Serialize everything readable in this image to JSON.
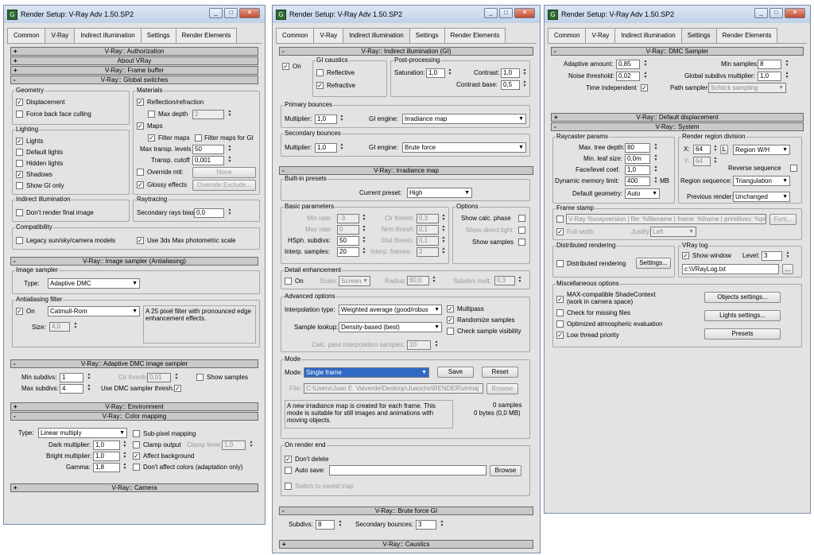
{
  "window_title": "Render Setup: V-Ray Adv 1.50.SP2",
  "tabs": [
    "Common",
    "V-Ray",
    "Indirect illumination",
    "Settings",
    "Render Elements"
  ],
  "w1": {
    "r_auth": "V-Ray:: Authorization",
    "r_about": "About VRay",
    "r_fb": "V-Ray:: Frame buffer",
    "r_gs": "V-Ray:: Global switches",
    "geometry": "Geometry",
    "displacement": "Displacement",
    "force_back": "Force back face culling",
    "lighting": "Lighting",
    "lights": "Lights",
    "default_lights": "Default lights",
    "hidden_lights": "Hidden lights",
    "shadows": "Shadows",
    "show_gi_only": "Show GI only",
    "materials": "Materials",
    "refl_refr": "Reflection/refraction",
    "max_depth": "Max depth",
    "max_depth_val": "2",
    "maps": "Maps",
    "filter_maps": "Filter maps",
    "filter_maps_gi": "Filter maps for GI",
    "max_transp": "Max transp. levels",
    "max_transp_val": "50",
    "transp_cutoff": "Transp. cutoff",
    "transp_cutoff_val": "0,001",
    "override_mtl": "Override mtl:",
    "none_btn": "None",
    "glossy": "Glossy effects",
    "override_excl": "Override Exclude...",
    "indirect": "Indirect illumination",
    "dont_render": "Don't render final image",
    "raytracing": "Raytracing",
    "sec_bias": "Secondary rays bias",
    "sec_bias_val": "0,0",
    "compat": "Compatibility",
    "legacy": "Legacy sun/sky/camera models",
    "use3ds": "Use 3ds Max photometric scale",
    "r_is": "V-Ray:: Image sampler (Antialiasing)",
    "image_sampler": "Image sampler",
    "type": "Type:",
    "type_val": "Adaptive DMC",
    "aa_filter": "Antialiasing filter",
    "on": "On",
    "filter_val": "Catmull-Rom",
    "filter_desc": "A 25 pixel filter with pronounced edge enhancement effects.",
    "size": "Size:",
    "size_val": "4,0",
    "r_admc": "V-Ray:: Adaptive DMC image sampler",
    "min_subdivs": "Min subdivs:",
    "min_subdivs_val": "1",
    "clr_thresh": "Clr thresh:",
    "clr_thresh_val": "0,01",
    "show_samples": "Show samples",
    "max_subdivs": "Max subdivs:",
    "max_subdivs_val": "4",
    "use_dmc": "Use DMC sampler thresh.",
    "r_env": "V-Ray:: Environment",
    "r_cm": "V-Ray:: Color mapping",
    "cm_type": "Type:",
    "cm_type_val": "Linear multiply",
    "sub_pixel": "Sub-pixel mapping",
    "dark_mult": "Dark multiplier:",
    "dark_mult_val": "1,0",
    "clamp_output": "Clamp output",
    "clamp_level": "Clamp level:",
    "clamp_level_val": "1,0",
    "bright_mult": "Bright multiplier:",
    "bright_mult_val": "1,0",
    "affect_bg": "Affect background",
    "gamma": "Gamma:",
    "gamma_val": "1,8",
    "dont_affect": "Don't affect colors (adaptation only)",
    "r_cam": "V-Ray:: Camera"
  },
  "w2": {
    "r_gi": "V-Ray:: Indirect illumination (GI)",
    "on": "On",
    "gi_caustics": "GI caustics",
    "reflective": "Reflective",
    "refractive": "Refractive",
    "post": "Post-processing",
    "saturation": "Saturation:",
    "saturation_val": "1,0",
    "contrast": "Contrast:",
    "contrast_val": "1,0",
    "contrast_base": "Contrast base:",
    "contrast_base_val": "0,5",
    "primary": "Primary bounces",
    "multiplier": "Multiplier:",
    "mult1_val": "1,0",
    "gi_engine": "GI engine:",
    "gi_engine1": "Irradiance map",
    "secondary": "Secondary bounces",
    "mult2_val": "1,0",
    "gi_engine2": "Brute force",
    "r_irr": "V-Ray:: Irradiance map",
    "builtin": "Built-in presets",
    "current_preset": "Current preset:",
    "preset_val": "High",
    "basic": "Basic parameters",
    "min_rate": "Min rate:",
    "min_rate_val": "-3",
    "max_rate": "Max rate:",
    "max_rate_val": "0",
    "hsph": "HSph. subdivs:",
    "hsph_val": "50",
    "interp": "Interp. samples:",
    "interp_val": "20",
    "clr_thresh": "Clr thresh:",
    "clr_thresh_val": "0,3",
    "nrm_thresh": "Nrm thresh:",
    "nrm_thresh_val": "0,1",
    "dist_thresh": "Dist thresh:",
    "dist_thresh_val": "0,1",
    "interp_frames": "Interp. frames:",
    "interp_frames_val": "2",
    "options": "Options",
    "show_calc": "Show calc. phase",
    "show_direct": "Show direct light",
    "show_samples": "Show samples",
    "detail": "Detail enhancement",
    "scale": "Scale:",
    "scale_val": "Screen",
    "radius": "Radius:",
    "radius_val": "60,0",
    "subdivs_mult": "Subdivs mult.",
    "subdivs_mult_val": "0,3",
    "advanced": "Advanced options",
    "interp_type": "Interpolation type:",
    "interp_type_val": "Weighted average (good/robus",
    "multipass": "Multipass",
    "randomize": "Randomize samples",
    "sample_lookup": "Sample lookup:",
    "sample_lookup_val": "Density-based (best)",
    "check_vis": "Check sample visibility",
    "calc_pass": "Calc. pass interpolation samples:",
    "calc_pass_val": "10",
    "mode_grp": "Mode",
    "mode": "Mode:",
    "mode_val": "Single frame",
    "save": "Save",
    "reset": "Reset",
    "file": "File:",
    "file_val": "C:\\Users\\Juan E. Valverde\\Desktop\\Juancho\\RENDER\\virmaj",
    "browse": "Browse",
    "mode_desc": "A new irradiance map is created for each frame. This mode is suitable for still images and animations with moving objects.",
    "samples": "0 samples",
    "bytes": "0 bytes (0,0 MB)",
    "on_render_end": "On render end",
    "dont_delete": "Don't delete",
    "auto_save": "Auto save:",
    "switch_saved": "Switch to saved map",
    "r_bf": "V-Ray:: Brute force GI",
    "subdivs": "Subdivs:",
    "subdivs_val": "8",
    "sec_bounces": "Secondary bounces:",
    "sec_bounces_val": "3",
    "r_caust": "V-Ray:: Caustics"
  },
  "w3": {
    "r_dmc": "V-Ray:: DMC Sampler",
    "adaptive": "Adaptive amount:",
    "adaptive_val": "0,85",
    "min_samples": "Min samples:",
    "min_samples_val": "8",
    "noise": "Noise threshold:",
    "noise_val": "0,02",
    "global_subdivs": "Global subdivs multiplier:",
    "global_subdivs_val": "1,0",
    "time_indep": "Time independent",
    "path_sampler": "Path sampler:",
    "path_sampler_val": "Schlick sampling",
    "r_disp": "V-Ray:: Default displacement",
    "r_sys": "V-Ray:: System",
    "raycaster": "Raycaster params",
    "max_tree": "Max. tree depth:",
    "max_tree_val": "80",
    "min_leaf": "Min. leaf size:",
    "min_leaf_val": "0,0m",
    "face_level": "Face/level coef.",
    "face_level_val": "1,0",
    "dyn_mem": "Dynamic memory limit:",
    "dyn_mem_val": "400",
    "mb": "MB",
    "def_geom": "Default geometry:",
    "def_geom_val": "Auto",
    "region_div": "Render region division",
    "x": "X:",
    "x_val": "64",
    "l": "L",
    "region_wh": "Region W/H",
    "y": "Y:",
    "y_val": "64",
    "reverse": "Reverse sequence",
    "region_seq": "Region sequence:",
    "region_seq_val": "Triangulation",
    "prev_render": "Previous render:",
    "prev_render_val": "Unchanged",
    "frame_stamp": "Frame stamp",
    "stamp_val": "V-Ray %vrayversion | file: %filename | frame: %frame | primitives: %primitiv",
    "font": "Font...",
    "full_width": "Full width",
    "justify": "Justify:",
    "justify_val": "Left",
    "dist_render_grp": "Distributed rendering",
    "dist_render": "Distributed rendering",
    "settings_btn": "Settings...",
    "vray_log": "VRay log",
    "show_window": "Show window",
    "level": "Level:",
    "level_val": "3",
    "log_path": "c:\\VRayLog.txt",
    "dots": "...",
    "misc": "Miscellaneous options",
    "max_compat": "MAX-compatible ShadeContext",
    "work_cam": "(work in camera space)",
    "check_missing": "Check for missing files",
    "optimized": "Optimized atmospheric evaluation",
    "low_thread": "Low thread priority",
    "objects_settings": "Objects settings...",
    "lights_settings": "Lights settings...",
    "presets": "Presets"
  }
}
